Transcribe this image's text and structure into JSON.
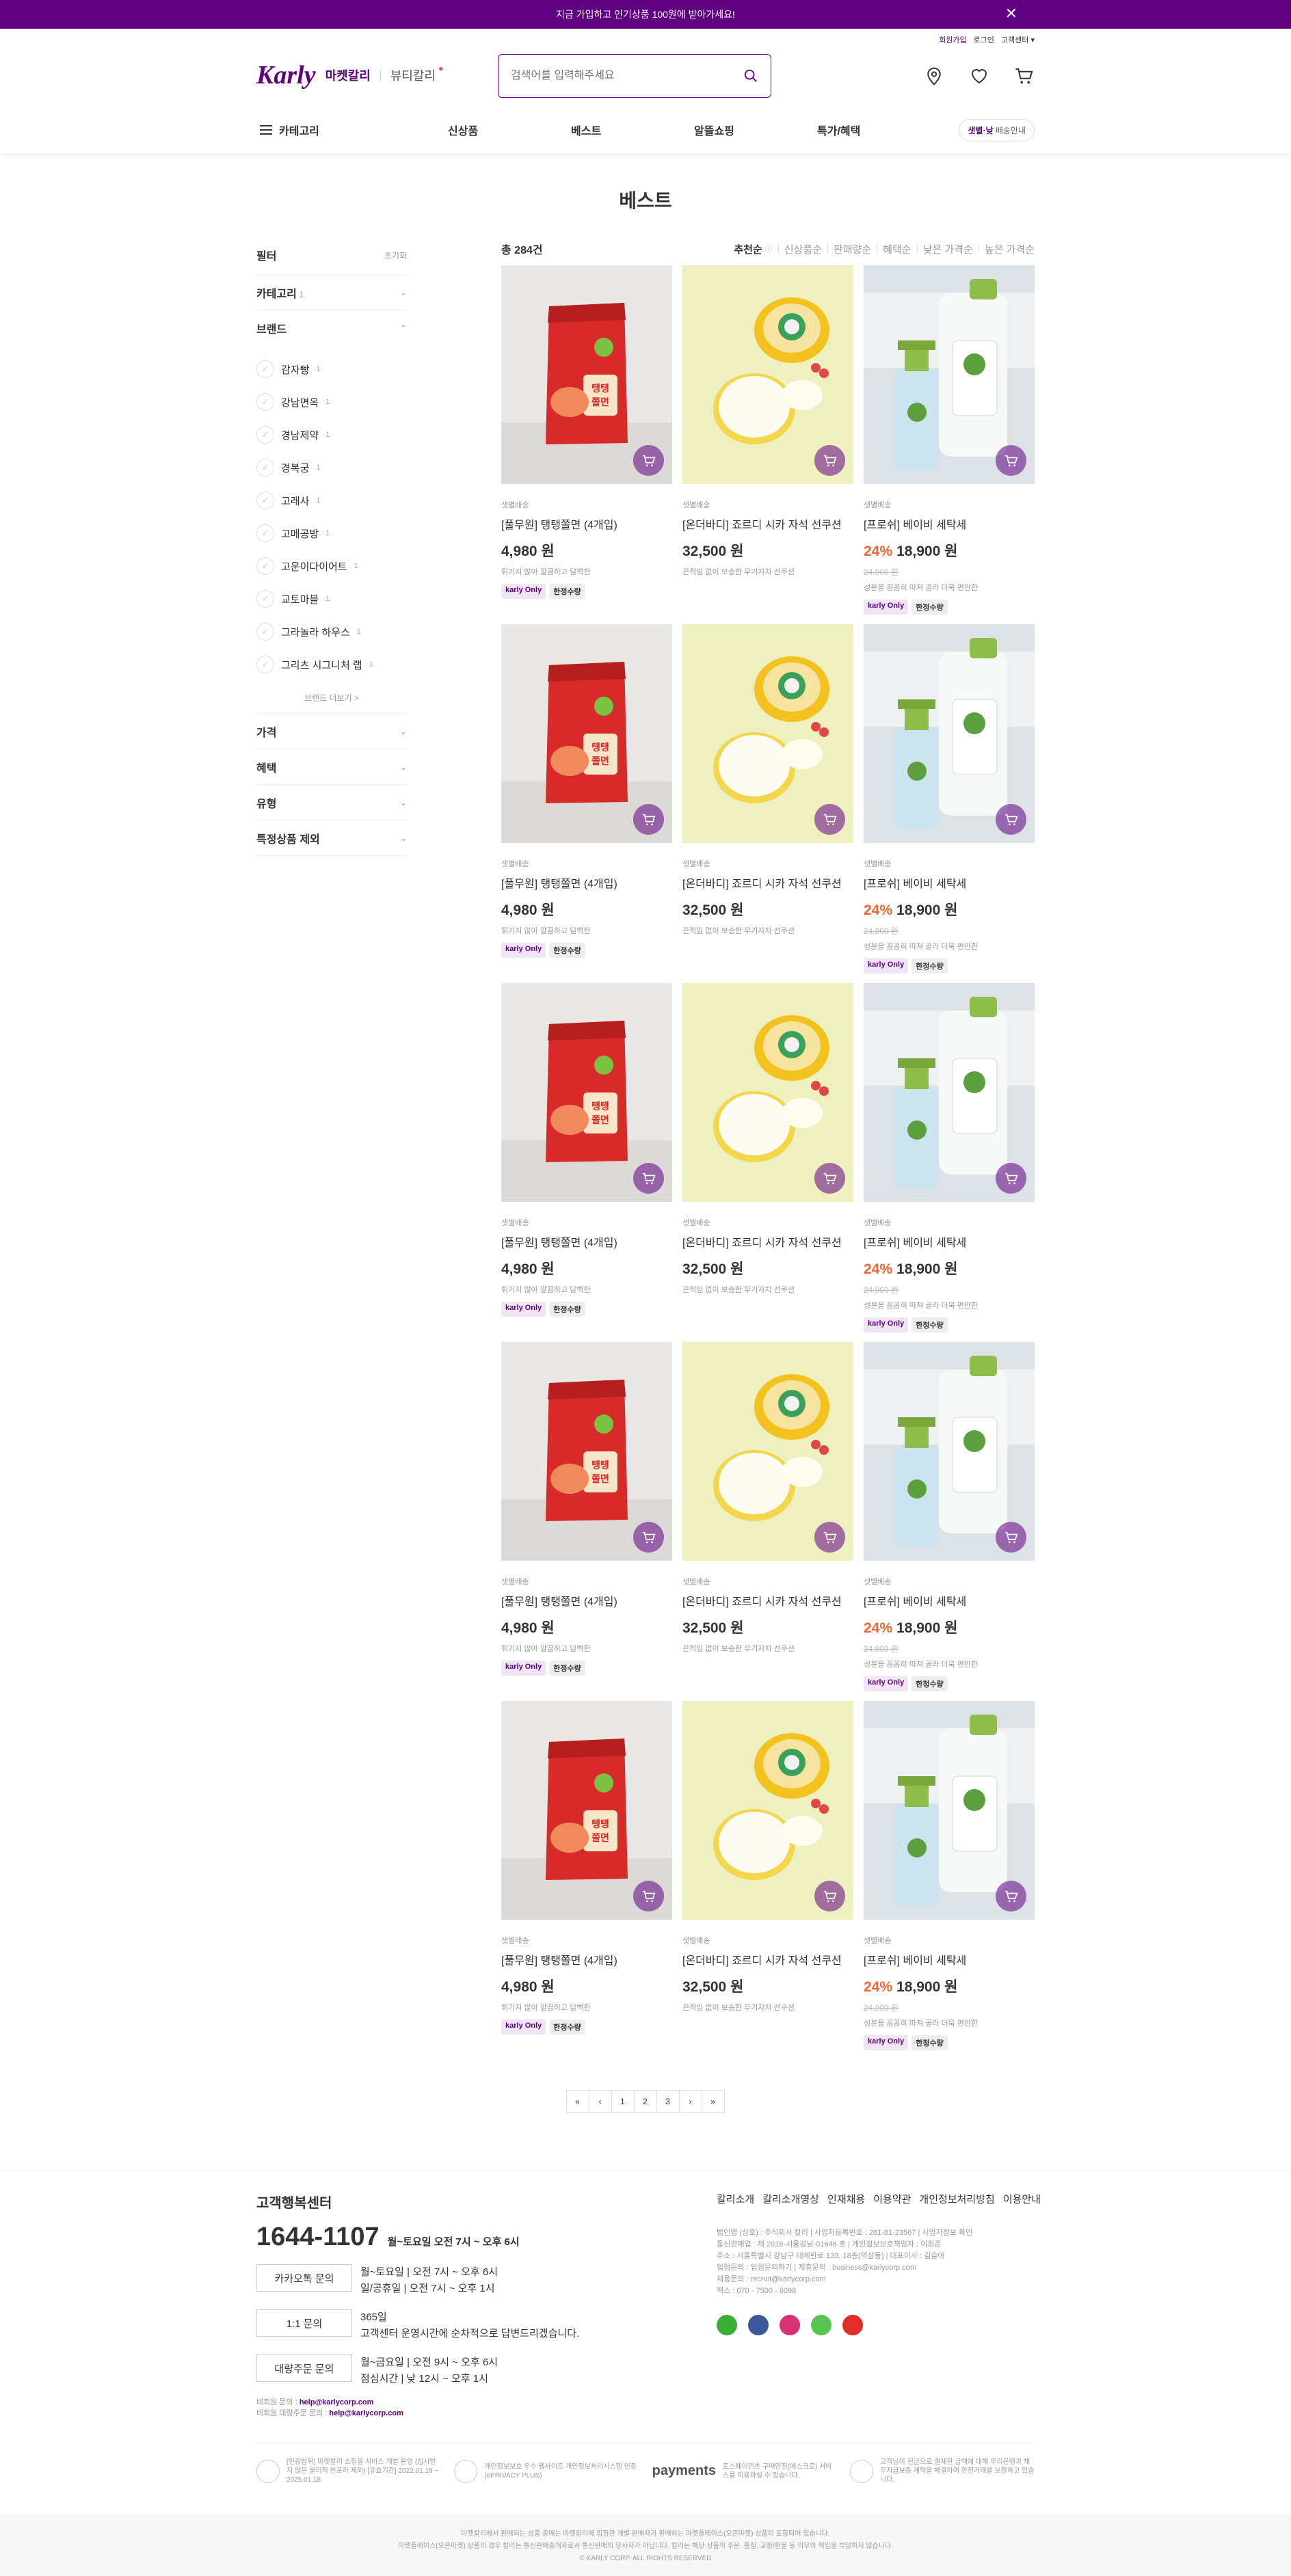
{
  "banner": {
    "text": "지금 가입하고 인기상품 100원에 받아가세요!",
    "close": "✕"
  },
  "usermenu": {
    "join": "회원가입",
    "login": "로그인",
    "service": "고객센터 ▾"
  },
  "header": {
    "logo": "Karly",
    "market": "마켓칼리",
    "beauty": "뷰티칼리",
    "search_placeholder": "검색어를 입력해주세요"
  },
  "gnb": {
    "category": "카테고리",
    "menu": [
      "신상품",
      "베스트",
      "알뜰쇼핑",
      "특가/혜택"
    ],
    "delivery_prefix": "샛별·낮",
    "delivery_suffix": " 배송안내"
  },
  "page_title": "베스트",
  "filter": {
    "title": "필터",
    "reset": "초기화",
    "category_label": "카테고리",
    "category_count": "1",
    "brand_label": "브랜드",
    "brands": [
      {
        "name": "감자빵",
        "count": "1"
      },
      {
        "name": "강남면옥",
        "count": "1"
      },
      {
        "name": "경남제약",
        "count": "1"
      },
      {
        "name": "경복궁",
        "count": "1"
      },
      {
        "name": "고래사",
        "count": "1"
      },
      {
        "name": "고메공방",
        "count": "1"
      },
      {
        "name": "고운이다이어트",
        "count": "1"
      },
      {
        "name": "교토마블",
        "count": "1"
      },
      {
        "name": "그라놀라 하우스",
        "count": "1"
      },
      {
        "name": "그리츠 시그니처 랩",
        "count": "1"
      }
    ],
    "brand_more": "브랜드 더보기 >",
    "sections": [
      "가격",
      "혜택",
      "유형",
      "특정상품 제외"
    ]
  },
  "list": {
    "total": "총 284건",
    "sorts": [
      "추천순",
      "신상품순",
      "판매량순",
      "혜택순",
      "낮은 가격순",
      "높은 가격순"
    ]
  },
  "products": [
    {
      "kind": "noodle",
      "type": "샛별배송",
      "name": "[풀무원] 탱탱쫄면 (4개입)",
      "discount": "",
      "price": "4,980 원",
      "old_price": "",
      "desc": "튀기지 않아 깔끔하고 담백한",
      "tags": [
        "karly Only",
        "한정수량"
      ]
    },
    {
      "kind": "cushion",
      "type": "샛별배송",
      "name": "[온더바디] 죠르디 시카 자석 선쿠션",
      "discount": "",
      "price": "32,500 원",
      "old_price": "",
      "desc": "끈적임 없이 보송한 무기자차 선쿠션",
      "tags": []
    },
    {
      "kind": "detergent",
      "type": "샛별배송",
      "name": "[프로쉬] 베이비 세탁세",
      "discount": "24%",
      "price": "18,900 원",
      "old_price": "24,900 원",
      "desc": "성분을 꼼꼼히 따져 골라 더욱 편안한",
      "tags": [
        "karly Only",
        "한정수량"
      ]
    },
    {
      "kind": "noodle",
      "type": "샛별배송",
      "name": "[풀무원] 탱탱쫄면 (4개입)",
      "discount": "",
      "price": "4,980 원",
      "old_price": "",
      "desc": "튀기지 않아 깔끔하고 담백한",
      "tags": [
        "karly Only",
        "한정수량"
      ]
    },
    {
      "kind": "cushion",
      "type": "샛별배송",
      "name": "[온더바디] 죠르디 시카 자석 선쿠션",
      "discount": "",
      "price": "32,500 원",
      "old_price": "",
      "desc": "끈적임 없이 보송한 무기자차 선쿠션",
      "tags": []
    },
    {
      "kind": "detergent",
      "type": "샛별배송",
      "name": "[프로쉬] 베이비 세탁세",
      "discount": "24%",
      "price": "18,900 원",
      "old_price": "24,900 원",
      "desc": "성분을 꼼꼼히 따져 골라 더욱 편안한",
      "tags": [
        "karly Only",
        "한정수량"
      ]
    },
    {
      "kind": "noodle",
      "type": "샛별배송",
      "name": "[풀무원] 탱탱쫄면 (4개입)",
      "discount": "",
      "price": "4,980 원",
      "old_price": "",
      "desc": "튀기지 않아 깔끔하고 담백한",
      "tags": [
        "karly Only",
        "한정수량"
      ]
    },
    {
      "kind": "cushion",
      "type": "샛별배송",
      "name": "[온더바디] 죠르디 시카 자석 선쿠션",
      "discount": "",
      "price": "32,500 원",
      "old_price": "",
      "desc": "끈적임 없이 보송한 무기자차 선쿠션",
      "tags": []
    },
    {
      "kind": "detergent",
      "type": "샛별배송",
      "name": "[프로쉬] 베이비 세탁세",
      "discount": "24%",
      "price": "18,900 원",
      "old_price": "24,900 원",
      "desc": "성분을 꼼꼼히 따져 골라 더욱 편안한",
      "tags": [
        "karly Only",
        "한정수량"
      ]
    },
    {
      "kind": "noodle",
      "type": "샛별배송",
      "name": "[풀무원] 탱탱쫄면 (4개입)",
      "discount": "",
      "price": "4,980 원",
      "old_price": "",
      "desc": "튀기지 않아 깔끔하고 담백한",
      "tags": [
        "karly Only",
        "한정수량"
      ]
    },
    {
      "kind": "cushion",
      "type": "샛별배송",
      "name": "[온더바디] 죠르디 시카 자석 선쿠션",
      "discount": "",
      "price": "32,500 원",
      "old_price": "",
      "desc": "끈적임 없이 보송한 무기자차 선쿠션",
      "tags": []
    },
    {
      "kind": "detergent",
      "type": "샛별배송",
      "name": "[프로쉬] 베이비 세탁세",
      "discount": "24%",
      "price": "18,900 원",
      "old_price": "24,900 원",
      "desc": "성분을 꼼꼼히 따져 골라 더욱 편안한",
      "tags": [
        "karly Only",
        "한정수량"
      ]
    },
    {
      "kind": "noodle",
      "type": "샛별배송",
      "name": "[풀무원] 탱탱쫄면 (4개입)",
      "discount": "",
      "price": "4,980 원",
      "old_price": "",
      "desc": "튀기지 않아 깔끔하고 담백한",
      "tags": [
        "karly Only",
        "한정수량"
      ]
    },
    {
      "kind": "cushion",
      "type": "샛별배송",
      "name": "[온더바디] 죠르디 시카 자석 선쿠션",
      "discount": "",
      "price": "32,500 원",
      "old_price": "",
      "desc": "끈적임 없이 보송한 무기자차 선쿠션",
      "tags": []
    },
    {
      "kind": "detergent",
      "type": "샛별배송",
      "name": "[프로쉬] 베이비 세탁세",
      "discount": "24%",
      "price": "18,900 원",
      "old_price": "24,900 원",
      "desc": "성분을 꼼꼼히 따져 골라 더욱 편안한",
      "tags": [
        "karly Only",
        "한정수량"
      ]
    }
  ],
  "pager": [
    "«",
    "‹",
    "1",
    "2",
    "3",
    "›",
    "»"
  ],
  "footer": {
    "cc_title": "고객행복센터",
    "tel": "1644-1107",
    "tel_hours": "월~토요일 오전 7시 ~ 오후 6시",
    "rows": [
      {
        "btn": "카카오톡 문의",
        "lines": [
          "월~토요일 | 오전 7시 ~ 오후 6시",
          "일/공휴일 | 오전 7시 ~ 오후 1시"
        ]
      },
      {
        "btn": "1:1 문의",
        "lines": [
          "365일",
          "고객센터 운영시간에 순차적으로 답변드리겠습니다."
        ]
      },
      {
        "btn": "대량주문 문의",
        "lines": [
          "월~금요일 | 오전 9시 ~ 오후 6시",
          "점심시간 | 낮 12시 ~ 오후 1시"
        ]
      }
    ],
    "mail1_label": "비회원 문의 : ",
    "mail1": "help@karlycorp.com",
    "mail2_label": "비회원 대량주문 문의 : ",
    "mail2": "help@karlycorp.com",
    "links": [
      "칼리소개",
      "칼리소개영상",
      "인재채용",
      "이용약관",
      "개인정보처리방침",
      "이용안내"
    ],
    "company": [
      "법인명 (상호) : 주식회사 칼리 | 사업자등록번호 : 261-81-23567 | 사업자정보 확인",
      "통신판매업 : 제 2018-서울강남-01646 호 | 개인정보보호책임자 : 이원준",
      "주소 : 서울특별시 강남구 테헤란로 133, 18층(역삼동) | 대표이사 : 김슬아",
      "입점문의 : 입점문의하기 | 제휴문의 : business@karlycorp.com",
      "채용문의 : recruit@karlycorp.com",
      "팩스 : 070 - 7500 - 6098"
    ],
    "social_colors": [
      "#3bae36",
      "#3b5998",
      "#d93175",
      "#5ac451",
      "#e52d27"
    ],
    "certs": [
      "[인증범위] 마켓칼리 쇼핑몰 서비스 개발 운영 (심사받지 않은 물리적 인프라 제외) [유효기간] 2022.01.19 ~ 2025.01.18",
      "개인정보보호 우수 웹사이트 개인정보처리시스템 인증 (ePRIVACY PLUS)",
      "토스페이먼츠 구매안전(에스크로) 서비스를 이용하실 수 있습니다.",
      "고객님이 현금으로 결제한 금액에 대해 우리은행과 채무지급보증 계약을 체결하여 안전거래를 보장하고 있습니다."
    ],
    "payments": "payments",
    "bottom": [
      "마켓칼리에서 판매되는 상품 중에는 마켓칼리에 입점한 개별 판매자가 판매하는 마켓플레이스(오픈마켓) 상품이 포함되어 있습니다.",
      "마켓플레이스(오픈마켓) 상품의 경우 칼리는 통신판매중개자로서 통신판매의 당사자가 아닙니다. 칼리는 해당 상품의 주문, 품질, 교환/환불 등 의무와 책임을 부담하지 않습니다.",
      "© KARLY CORP. ALL RIGHTS RESERVED"
    ]
  },
  "colors": {
    "brand": "#5f0080",
    "discount": "#fa622f"
  }
}
